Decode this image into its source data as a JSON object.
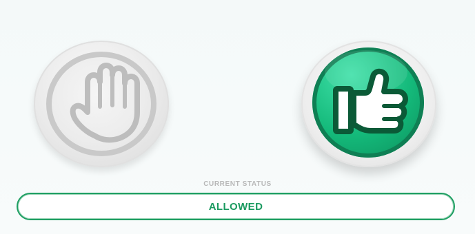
{
  "buttons": {
    "stop": {
      "icon": "hand-stop-icon",
      "state": "inactive"
    },
    "allow": {
      "icon": "thumbs-up-icon",
      "state": "active"
    }
  },
  "status": {
    "label": "CURRENT STATUS",
    "value": "ALLOWED",
    "accent_color": "#1b9a60"
  }
}
